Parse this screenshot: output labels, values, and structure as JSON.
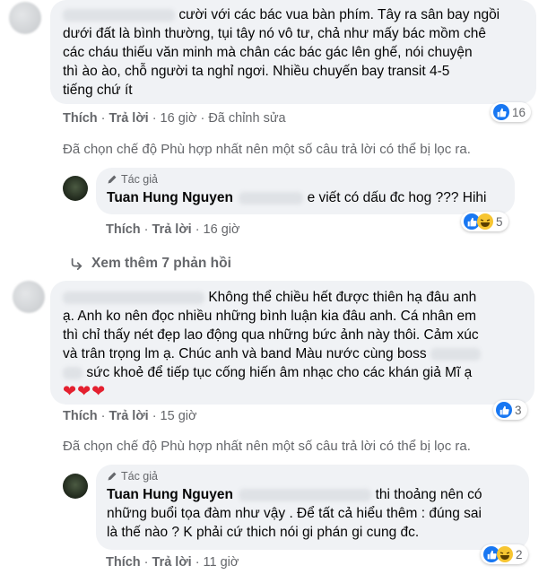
{
  "comment1": {
    "text_lines": [
      "cười với các bác vua bàn phím. Tây ra sân bay ngồi",
      "dưới đất là bình thường, tụi tây nó vô tư, chả như mấy bác mồm chê",
      "các cháu thiếu văn minh mà chân các bác gác lên ghế, nói chuyện",
      "thì ào ào, chỗ người ta nghỉ ngơi. Nhiều chuyến bay transit 4-5",
      "tiếng chứ ít"
    ],
    "like": "Thích",
    "reply": "Trả lời",
    "time": "16 giờ",
    "edited": "Đã chỉnh sửa",
    "reaction_count": "16",
    "filter_note": "Đã chọn chế độ Phù hợp nhất nên một số câu trả lời có thể bị lọc ra."
  },
  "reply1": {
    "author_tag": "Tác giả",
    "name": "Tuan Hung Nguyen",
    "text": "e viết có dấu đc hog ??? Hihi",
    "like": "Thích",
    "reply": "Trả lời",
    "time": "16 giờ",
    "reaction_count": "5"
  },
  "see_more": "Xem thêm 7 phản hồi",
  "comment2": {
    "text_lines": [
      "Không thể chiều hết được thiên hạ đâu anh",
      "ạ. Anh ko nên đọc nhiều những bình luận kia đâu anh. Cá nhân em",
      "thì chỉ thấy nét đẹp lao động qua những bức ảnh này thôi. Cảm xúc",
      "và trân trọng lm ạ. Chúc anh và band Màu nước cùng boss",
      "sức khoẻ để tiếp tục cống hiến âm nhạc cho các khán giả Mĩ ạ"
    ],
    "hearts": "❤❤❤",
    "like": "Thích",
    "reply": "Trả lời",
    "time": "15 giờ",
    "reaction_count": "3",
    "filter_note": "Đã chọn chế độ Phù hợp nhất nên một số câu trả lời có thể bị lọc ra."
  },
  "reply2": {
    "author_tag": "Tác giả",
    "name": "Tuan Hung Nguyen",
    "text_lines": [
      "thi thoảng nên có",
      "những buổi tọa đàm như vậy . Để tất cả hiểu thêm : đúng sai",
      "là thế nào ? K phải cứ thich nói gi phán gi cung đc."
    ],
    "like": "Thích",
    "reply": "Trả lời",
    "time": "11 giờ",
    "reaction_count": "2"
  },
  "colors": {
    "like_blue": "#1877f2",
    "muted": "#65676b",
    "bubble": "#f0f2f5",
    "heart": "#e4202f"
  }
}
